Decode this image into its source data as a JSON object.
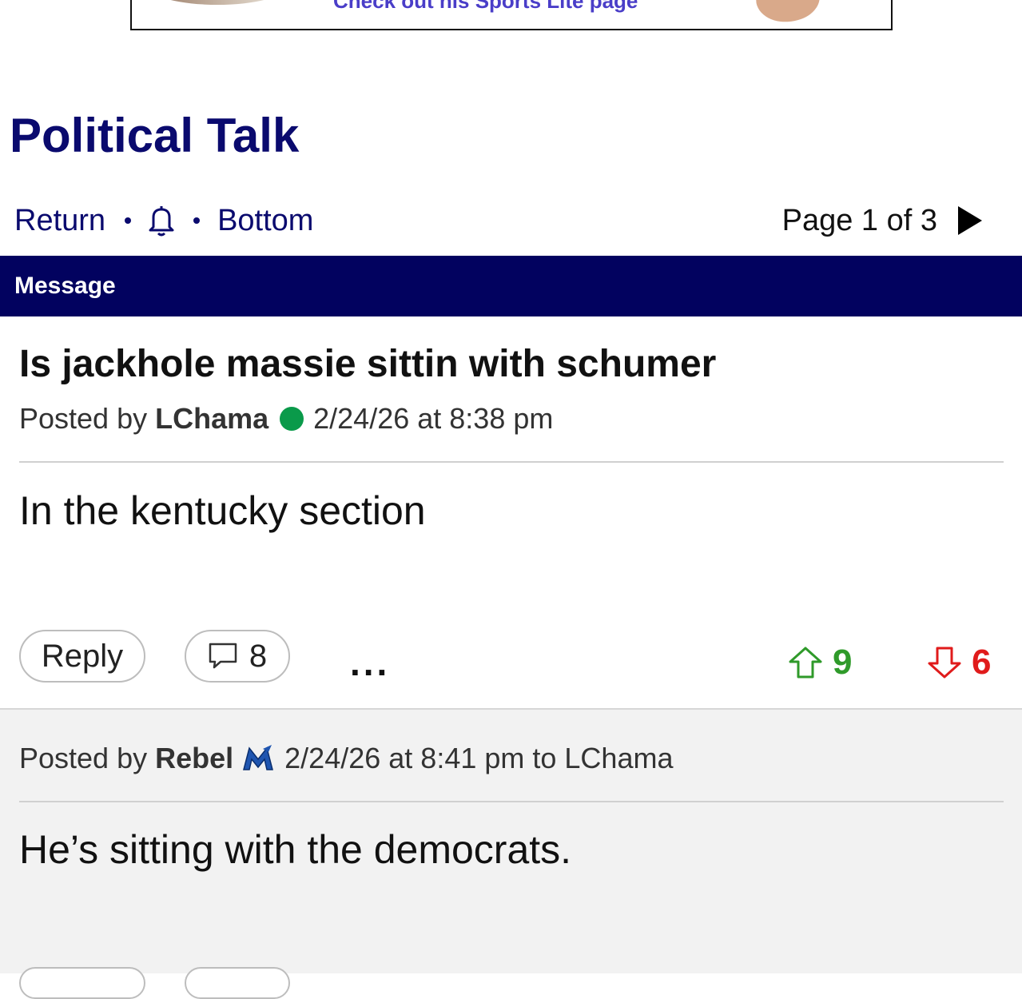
{
  "ad": {
    "text": "Check out his Sports Lite page"
  },
  "board": {
    "title": "Political Talk"
  },
  "nav": {
    "return_label": "Return",
    "bell_icon": "bell-icon",
    "bottom_label": "Bottom",
    "page_label": "Page 1 of 3"
  },
  "message_header": "Message",
  "post": {
    "title": "Is jackhole massie sittin with schumer",
    "posted_by_label": "Posted by",
    "author": "LChama",
    "timestamp": "2/24/26 at 8:38 pm",
    "body": "In the kentucky section",
    "reply_label": "Reply",
    "reply_count": "8",
    "more_label": "...",
    "upvotes": "9",
    "downvotes": "6",
    "colors": {
      "upvote": "#2f9a2a",
      "downvote": "#e01b1b",
      "online": "#0a9a4a"
    }
  },
  "reply": {
    "posted_by_label": "Posted by",
    "author": "Rebel",
    "timestamp": "2/24/26 at 8:41 pm to",
    "to_user": "LChama",
    "body": "He’s sitting with the democrats."
  },
  "colors": {
    "brand_navy": "#02025f",
    "link": "#0a0a6e"
  }
}
